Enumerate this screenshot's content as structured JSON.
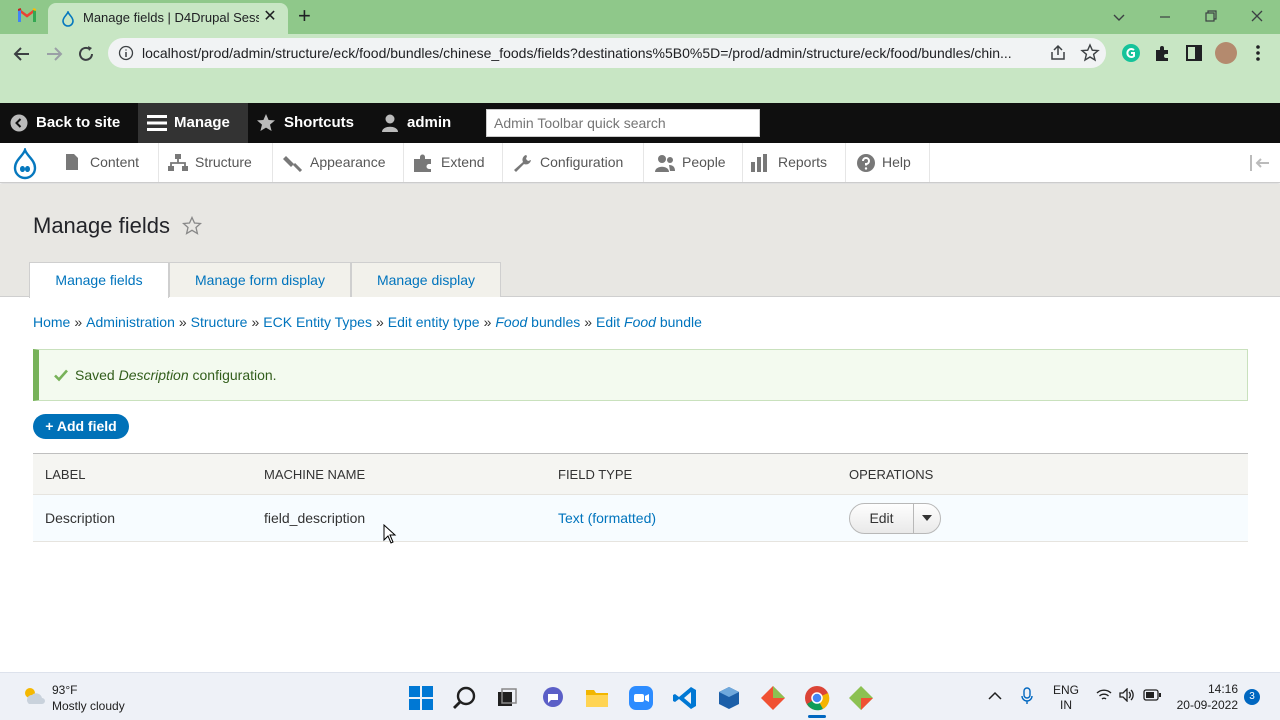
{
  "browser": {
    "tab_title": "Manage fields | D4Drupal Sessions",
    "tab_close": "✕",
    "new_tab": "+",
    "url": "localhost/prod/admin/structure/eck/food/bundles/chinese_foods/fields?destinations%5B0%5D=/prod/admin/structure/eck/food/bundles/chin...",
    "icons": [
      "gmail-icon",
      "drupal-favicon",
      "back-icon",
      "forward-icon",
      "reload-icon",
      "info-icon",
      "share-icon",
      "bookmark-star-icon",
      "grammarly-icon",
      "extensions-icon",
      "sidepanel-icon",
      "profile-avatar",
      "menu-dots-icon"
    ]
  },
  "admin_toolbar": {
    "back_to_site": "Back to site",
    "manage": "Manage",
    "shortcuts": "Shortcuts",
    "user": "admin",
    "search_placeholder": "Admin Toolbar quick search"
  },
  "tray": {
    "items": [
      "Content",
      "Structure",
      "Appearance",
      "Extend",
      "Configuration",
      "People",
      "Reports",
      "Help"
    ]
  },
  "page": {
    "title": "Manage fields",
    "tabs": [
      "Manage fields",
      "Manage form display",
      "Manage display"
    ],
    "active_tab": "Manage fields"
  },
  "breadcrumb": {
    "items": [
      {
        "text": "Home"
      },
      {
        "text": "Administration"
      },
      {
        "text": "Structure"
      },
      {
        "text": "ECK Entity Types"
      },
      {
        "text": "Edit entity type"
      },
      {
        "em": "Food",
        "text": " bundles"
      },
      {
        "text": "Edit ",
        "em2": "Food",
        "text2": " bundle"
      }
    ],
    "separator": "»"
  },
  "message": {
    "prefix": "Saved ",
    "emphasis": "Description",
    "suffix": " configuration."
  },
  "add_field_label": "+ Add field",
  "fields_table": {
    "headers": [
      "Label",
      "Machine name",
      "Field type",
      "Operations"
    ],
    "rows": [
      {
        "label": "Description",
        "machine_name": "field_description",
        "field_type": "Text (formatted)",
        "operation": "Edit"
      }
    ]
  },
  "taskbar": {
    "weather_temp": "93°F",
    "weather_desc": "Mostly cloudy",
    "lang_top": "ENG",
    "lang_bottom": "IN",
    "time": "14:16",
    "date": "20-09-2022",
    "notification_count": "3"
  },
  "colors": {
    "drupal_blue": "#0074bd",
    "button_blue": "#0071b8",
    "success_green": "#77b259",
    "chrome_green": "#8fc88a"
  }
}
